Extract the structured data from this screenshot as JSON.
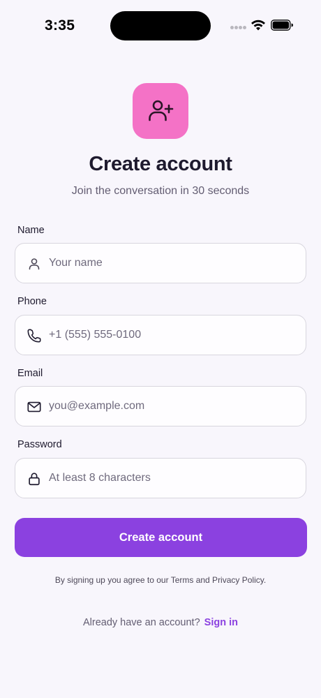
{
  "status_bar": {
    "time": "3:35"
  },
  "header": {
    "icon": "user-plus-icon",
    "title": "Create account",
    "subtitle": "Join the conversation in 30 seconds"
  },
  "form": {
    "name": {
      "label": "Name",
      "placeholder": "Your name",
      "icon": "person-icon"
    },
    "phone": {
      "label": "Phone",
      "placeholder": "+1 (555) 555-0100",
      "icon": "phone-icon"
    },
    "email": {
      "label": "Email",
      "placeholder": "you@example.com",
      "icon": "mail-icon"
    },
    "password": {
      "label": "Password",
      "placeholder": "At least 8 characters",
      "icon": "lock-icon"
    },
    "submit_label": "Create account"
  },
  "footer": {
    "terms": "By signing up you agree to our Terms and Privacy Policy.",
    "signin_prompt": "Already have an account?",
    "signin_link": "Sign in"
  },
  "colors": {
    "background": "#f8f6fc",
    "accent": "#8b41e0",
    "icon_tile": "#f472c6",
    "text_primary": "#1e1a2e",
    "text_secondary": "#635d72"
  }
}
